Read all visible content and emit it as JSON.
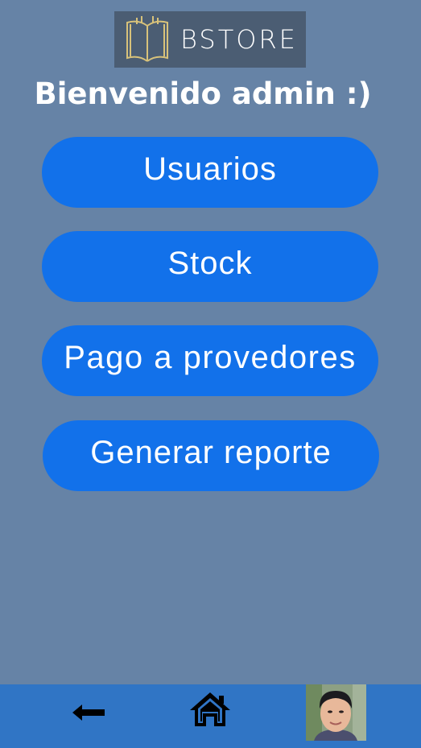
{
  "logo": {
    "text": "BSTORE",
    "icon": "open-book-icon"
  },
  "welcome": "Bienvenido admin :)",
  "menu": {
    "usuarios": "Usuarios",
    "stock": "Stock",
    "pagos": "Pago a provedores",
    "reporte": "Generar reporte"
  },
  "nav": {
    "back_icon": "back-arrow-icon",
    "home_icon": "home-icon",
    "avatar": "user-avatar"
  },
  "colors": {
    "background": "#6683a6",
    "button": "#1271ea",
    "bottom_bar": "#3075c5",
    "logo_bg": "#4b5d73"
  }
}
